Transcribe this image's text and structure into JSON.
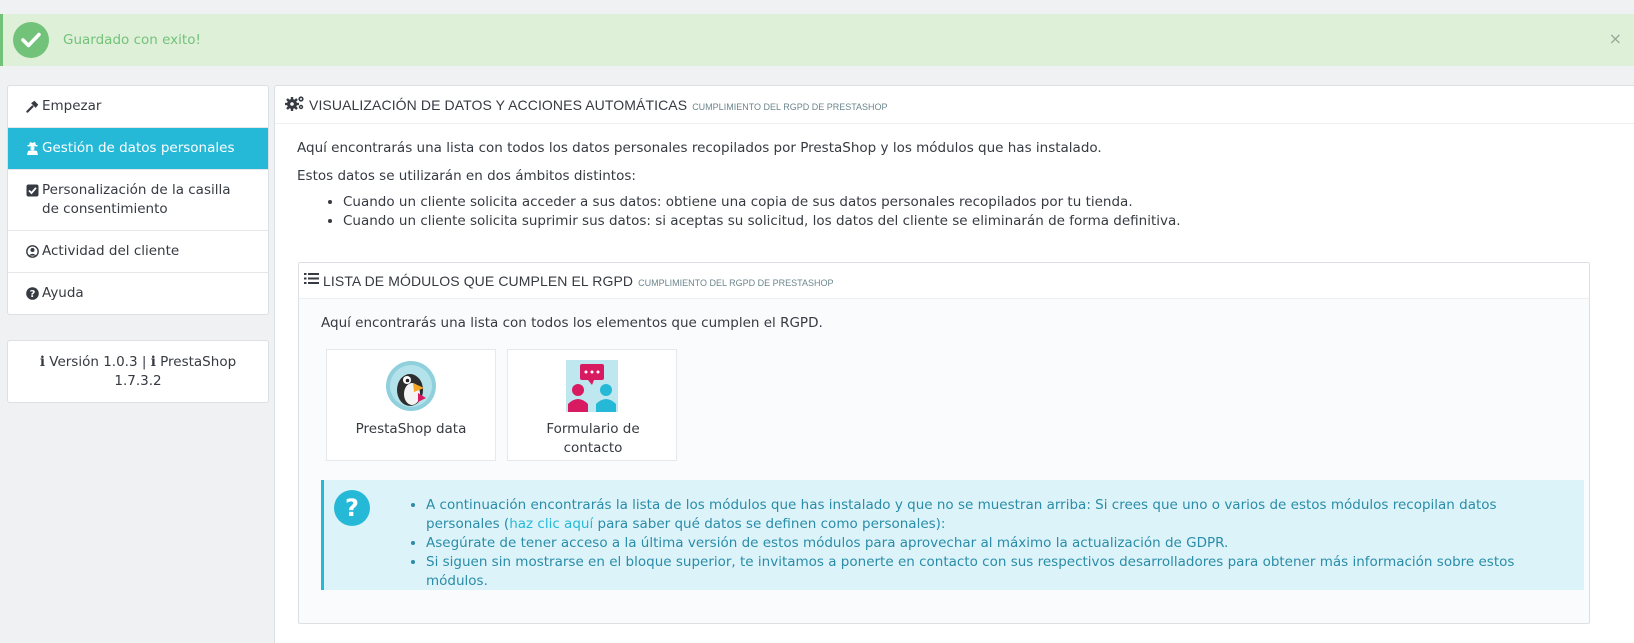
{
  "alert": {
    "message": "Guardado con exito!",
    "close": "×",
    "color": "#72c279"
  },
  "sidebar": {
    "items": [
      {
        "label": "Empezar",
        "icon": "hammer-icon",
        "active": false
      },
      {
        "label": "Gestión de datos personales",
        "icon": "user-secret-icon",
        "active": true
      },
      {
        "label": "Personalización de la casilla de consentimiento",
        "icon": "checkbox-icon",
        "active": false
      },
      {
        "label": "Actividad del cliente",
        "icon": "user-circle-icon",
        "active": false
      },
      {
        "label": "Ayuda",
        "icon": "question-circle-icon",
        "active": false
      }
    ],
    "active_color": "#25b9d7"
  },
  "version": {
    "line1": "Versión 1.0.3 |",
    "line1b": "PrestaShop",
    "line2": "1.7.3.2"
  },
  "main": {
    "title": "VISUALIZACIÓN DE DATOS Y ACCIONES AUTOMÁTICAS",
    "subtitle": "CUMPLIMIENTO DEL RGPD DE PRESTASHOP",
    "intro1": "Aquí encontrarás una lista con todos los datos personales recopilados por PrestaShop y los módulos que has instalado.",
    "intro2": "Estos datos se utilizarán en dos ámbitos distintos:",
    "bullets": [
      "Cuando un cliente solicita acceder a sus datos: obtiene una copia de sus datos personales recopilados por tu tienda.",
      "Cuando un cliente solicita suprimir sus datos: si aceptas su solicitud, los datos del cliente se eliminarán de forma definitiva."
    ]
  },
  "modules": {
    "title": "LISTA DE MÓDULOS QUE CUMPLEN EL RGPD",
    "subtitle": "CUMPLIMIENTO DEL RGPD DE PRESTASHOP",
    "intro": "Aquí encontrarás una lista con todos los elementos que cumplen el RGPD.",
    "cards": [
      {
        "name": "PrestaShop data"
      },
      {
        "name": "Formulario de contacto"
      }
    ]
  },
  "info": {
    "b1_pre": "A continuación encontrarás la lista de los módulos que has instalado y que no se muestran arriba: Si crees que uno o varios de estos módulos recopilan datos personales (",
    "b1_link": "haz clic aquí",
    "b1_post": " para saber qué datos se definen como personales):",
    "b2": "Asegúrate de tener acceso a la última versión de estos módulos para aprovechar al máximo la actualización de GDPR.",
    "b3": "Si siguen sin mostrarse en el bloque superior, te invitamos a ponerte en contacto con sus respectivos desarrolladores para obtener más información sobre estos módulos.",
    "accent": "#25b9d7"
  }
}
